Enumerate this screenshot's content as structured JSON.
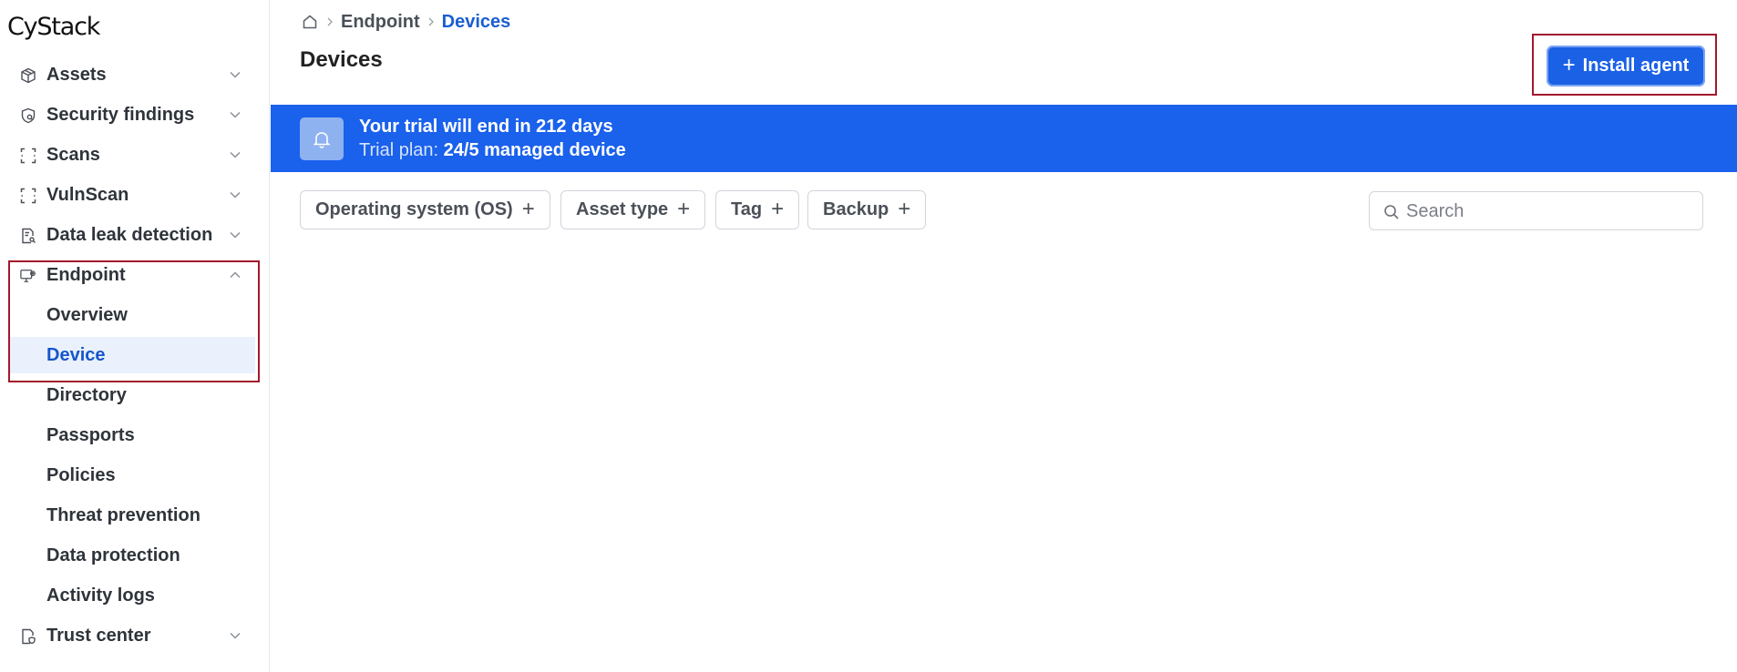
{
  "app": {
    "logo": "CyStack"
  },
  "sidebar": {
    "items": [
      {
        "label": "Assets",
        "icon": "box-icon"
      },
      {
        "label": "Security findings",
        "icon": "shield-search-icon"
      },
      {
        "label": "Scans",
        "icon": "scan-frame-icon"
      },
      {
        "label": "VulnScan",
        "icon": "scan-frame-icon"
      },
      {
        "label": "Data leak detection",
        "icon": "document-search-icon"
      },
      {
        "label": "Endpoint",
        "icon": "monitor-gear-icon"
      },
      {
        "label": "Trust center",
        "icon": "file-shield-icon"
      }
    ],
    "endpoint_sub": [
      {
        "label": "Overview"
      },
      {
        "label": "Device"
      },
      {
        "label": "Directory"
      },
      {
        "label": "Passports"
      },
      {
        "label": "Policies"
      },
      {
        "label": "Threat prevention"
      },
      {
        "label": "Data protection"
      },
      {
        "label": "Activity logs"
      }
    ]
  },
  "breadcrumb": {
    "items": [
      "Endpoint",
      "Devices"
    ]
  },
  "page": {
    "title": "Devices"
  },
  "actions": {
    "install_agent": "Install agent"
  },
  "banner": {
    "headline": "Your trial will end in 212 days",
    "plan_prefix": "Trial plan:",
    "plan_value": "24/5 managed device",
    "color": "#1a61ec"
  },
  "filters": [
    "Operating system (OS)",
    "Asset type",
    "Tag",
    "Backup"
  ],
  "search": {
    "placeholder": "Search",
    "value": ""
  },
  "colors": {
    "accent": "#1b61e6",
    "active_text": "#1656c9",
    "highlight": "#a3182c"
  }
}
